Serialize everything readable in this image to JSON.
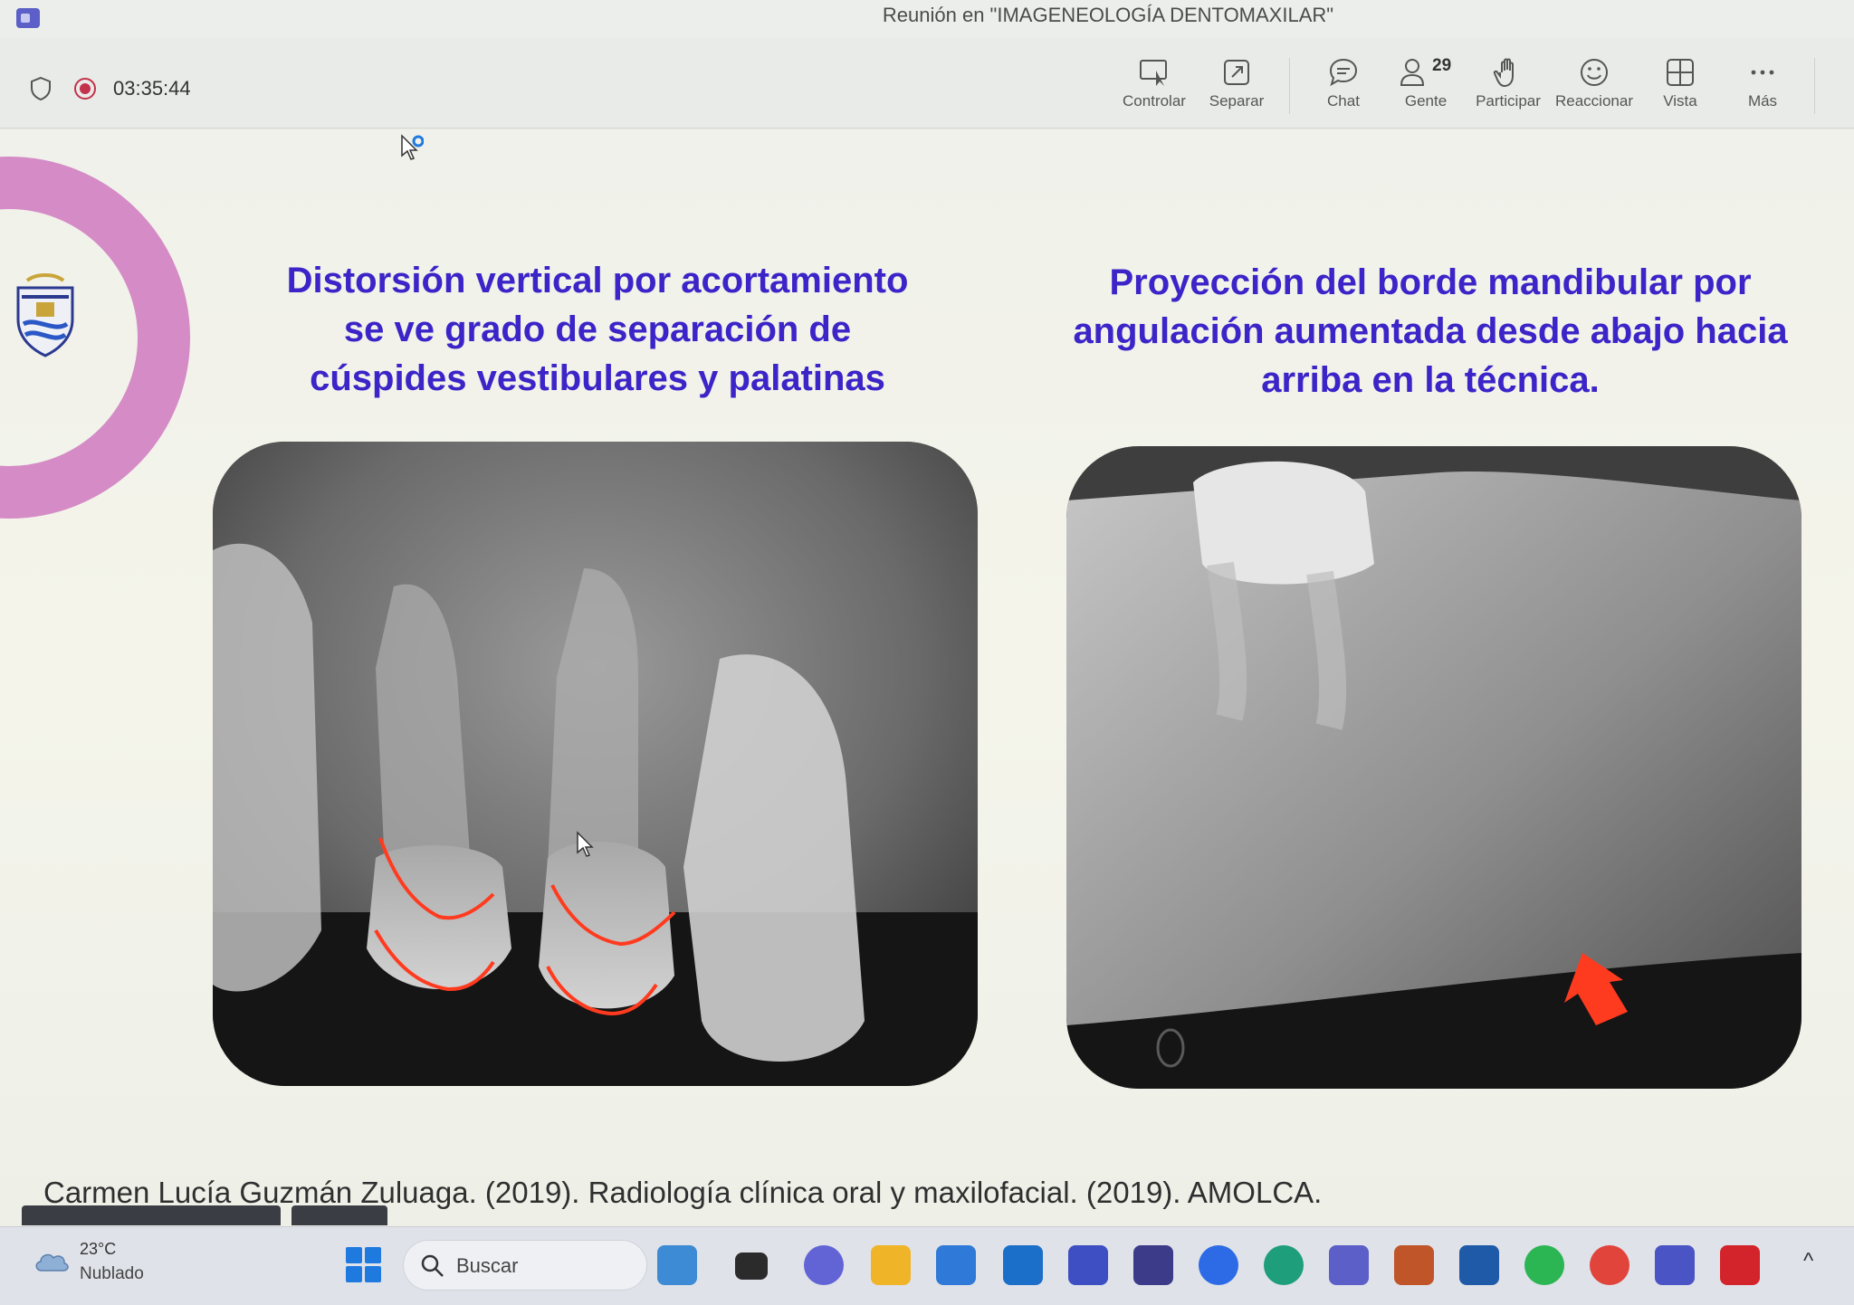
{
  "window": {
    "title": "Reunión en \"IMAGENEOLOGÍA DENTOMAXILAR\""
  },
  "meeting": {
    "timer": "03:35:44",
    "toolbar": [
      {
        "id": "controlar",
        "label": "Controlar",
        "icon": "share-control-icon"
      },
      {
        "id": "separar",
        "label": "Separar",
        "icon": "pop-out-icon"
      },
      {
        "id": "chat",
        "label": "Chat",
        "icon": "chat-icon"
      },
      {
        "id": "gente",
        "label": "Gente",
        "icon": "people-icon",
        "count": "29"
      },
      {
        "id": "participar",
        "label": "Participar",
        "icon": "raise-hand-icon"
      },
      {
        "id": "reaccionar",
        "label": "Reaccionar",
        "icon": "smiley-icon"
      },
      {
        "id": "vista",
        "label": "Vista",
        "icon": "grid-view-icon"
      },
      {
        "id": "mas",
        "label": "Más",
        "icon": "more-dots-icon"
      }
    ]
  },
  "slide": {
    "heading_left_lines": [
      "Distorsión vertical por acortamiento",
      "se ve grado de separación de",
      "cúspides vestibulares y palatinas"
    ],
    "heading_right_lines": [
      "Proyección del borde mandibular por",
      "angulación aumentada desde abajo hacia",
      "arriba en la técnica."
    ],
    "citation": "Carmen Lucía Guzmán Zuluaga. (2019). Radiología clínica oral y maxilofacial. (2019). AMOLCA.",
    "annotation_color": "#ff3b1f",
    "heading_color": "#3b24c8",
    "ring_color": "#d58bc6"
  },
  "taskbar": {
    "weather_temp": "23°C",
    "weather_condition": "Nublado",
    "search_placeholder": "Buscar",
    "apps": [
      "files-icon",
      "task-view-icon",
      "video-chat-icon",
      "folder-icon",
      "mail-icon",
      "cortana-icon",
      "pen-app-icon",
      "store-icon",
      "zoom-icon",
      "edge-icon",
      "teams-icon",
      "winrar-icon",
      "word-icon",
      "whatsapp-icon",
      "chrome-icon",
      "teams-new-icon",
      "mcafee-icon"
    ]
  }
}
